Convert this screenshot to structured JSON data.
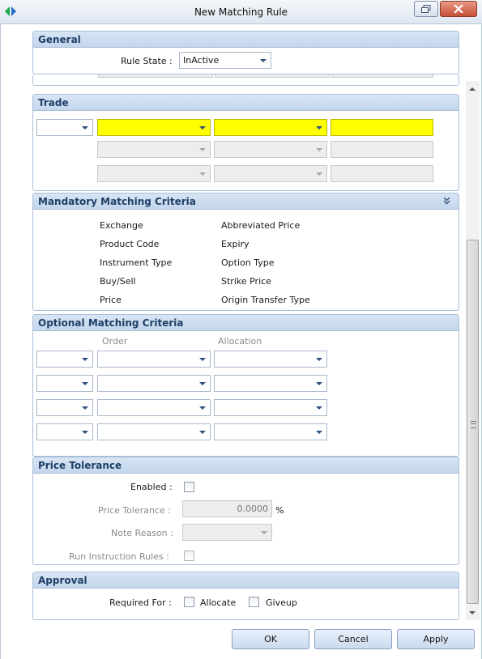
{
  "window": {
    "title": "New Matching Rule"
  },
  "general": {
    "heading": "General",
    "rule_state_label": "Rule State :",
    "rule_state_value": "InActive"
  },
  "trade": {
    "heading": "Trade"
  },
  "mandatory": {
    "heading": "Mandatory Matching Criteria",
    "left": [
      "Exchange",
      "Product Code",
      "Instrument Type",
      "Buy/Sell",
      "Price"
    ],
    "right": [
      "Abbreviated Price",
      "Expiry",
      "Option Type",
      "Strike Price",
      "Origin Transfer Type"
    ]
  },
  "optional": {
    "heading": "Optional Matching Criteria",
    "col_order": "Order",
    "col_allocation": "Allocation"
  },
  "price_tolerance": {
    "heading": "Price Tolerance",
    "enabled_label": "Enabled :",
    "tolerance_label": "Price Tolerance :",
    "tolerance_value": "0.0000",
    "tolerance_unit": "%",
    "note_reason_label": "Note Reason :",
    "run_rules_label": "Run Instruction Rules :"
  },
  "approval": {
    "heading": "Approval",
    "required_for_label": "Required For :",
    "allocate_label": "Allocate",
    "giveup_label": "Giveup"
  },
  "buttons": {
    "ok": "OK",
    "cancel": "Cancel",
    "apply": "Apply"
  }
}
